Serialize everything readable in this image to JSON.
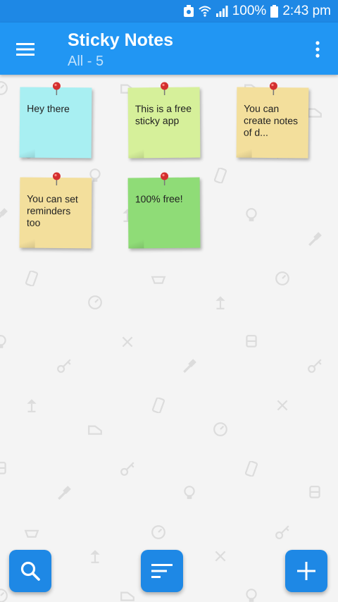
{
  "status_bar": {
    "battery_percent": "100%",
    "time": "2:43 pm",
    "icons": [
      "notification-icon",
      "wifi-icon",
      "signal-icon",
      "battery-icon"
    ]
  },
  "app_bar": {
    "title": "Sticky Notes",
    "subtitle": "All - 5",
    "menu_icon": "hamburger-menu-icon",
    "overflow_icon": "more-vertical-icon",
    "color": "#2196f3"
  },
  "notes": [
    {
      "text": "Hey there",
      "color": "#a8eff2"
    },
    {
      "text": "This is a free sticky app",
      "color": "#d6f09a"
    },
    {
      "text": "You can create notes of d...",
      "color": "#f3df9c"
    },
    {
      "text": "You can set reminders too",
      "color": "#f3df9c"
    },
    {
      "text": "100% free!",
      "color": "#8fdc77"
    }
  ],
  "fabs": {
    "search_icon": "search-icon",
    "sort_icon": "sort-icon",
    "add_icon": "add-icon",
    "color": "#1e88e5"
  }
}
